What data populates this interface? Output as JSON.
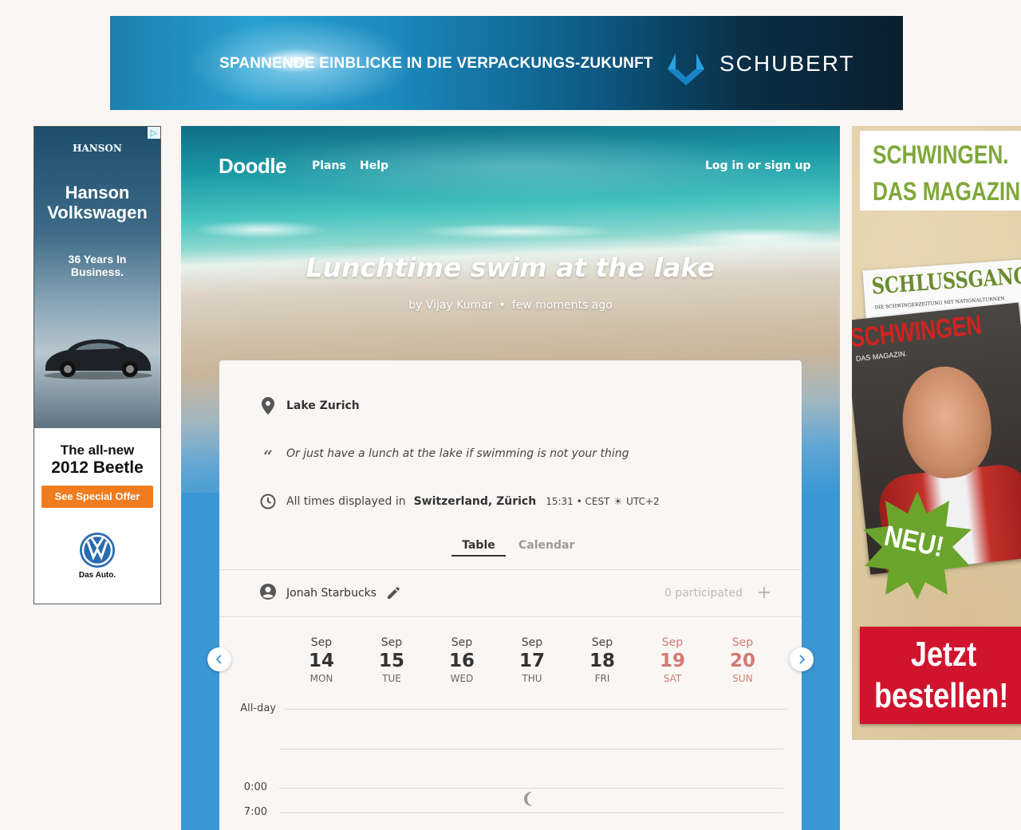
{
  "top_ad": {
    "headline": "SPANNENDE EINBLICKE IN DIE VERPACKUNGS-ZUKUNFT",
    "brand": "SCHUBERT"
  },
  "left_ad": {
    "dealer_logo": "HANSON",
    "title_line1": "Hanson",
    "title_line2": "Volkswagen",
    "tagline_line1": "36 Years In",
    "tagline_line2": "Business.",
    "model_line1": "The all-new",
    "model_line2": "2012 Beetle",
    "offer_button": "See Special Offer",
    "slogan": "Das Auto.",
    "adchoices_icon": "adchoices-icon"
  },
  "right_ad": {
    "headline_line1": "SCHWINGEN.",
    "headline_line2": "DAS MAGAZIN",
    "back_magazine_title": "SCHLUSSGANG",
    "back_magazine_sub": "DIE SCHWINGERZEITUNG MIT NATIONALTURNEN",
    "front_magazine_title": "SCHWINGEN",
    "front_magazine_sub": "DAS MAGAZIN.",
    "burst_text": "NEU!",
    "cta_line1": "Jetzt",
    "cta_line2": "bestellen!"
  },
  "header": {
    "logo": "Doodle",
    "nav": [
      "Plans",
      "Help"
    ],
    "login": "Log in or sign up"
  },
  "poll": {
    "title": "Lunchtime swim at the lake",
    "author": "by Vijay Kumar",
    "time_ago": "few moments ago",
    "location": "Lake Zurich",
    "description": "Or just have a lunch at the lake if swimming is not your thing",
    "timezone_prefix": "All times displayed in",
    "timezone_name": "Switzerland, Zürich",
    "timezone_time": "15:31 • CEST",
    "timezone_offset": "UTC+2"
  },
  "view_tabs": {
    "table": "Table",
    "calendar": "Calendar",
    "active": "Table"
  },
  "participant": {
    "name": "Jonah Starbucks",
    "count_label": "0 participated"
  },
  "days": [
    {
      "month": "Sep",
      "day": "14",
      "weekday": "MON",
      "weekend": false
    },
    {
      "month": "Sep",
      "day": "15",
      "weekday": "TUE",
      "weekend": false
    },
    {
      "month": "Sep",
      "day": "16",
      "weekday": "WED",
      "weekend": false
    },
    {
      "month": "Sep",
      "day": "17",
      "weekday": "THU",
      "weekend": false
    },
    {
      "month": "Sep",
      "day": "18",
      "weekday": "FRI",
      "weekend": false
    },
    {
      "month": "Sep",
      "day": "19",
      "weekday": "SAT",
      "weekend": true
    },
    {
      "month": "Sep",
      "day": "20",
      "weekday": "SUN",
      "weekend": true
    }
  ],
  "time_labels": {
    "all_day": "All-day",
    "t0": "0:00",
    "t7": "7:00"
  },
  "colors": {
    "weekend": "#d27a74",
    "card_bg": "#f9f6f4",
    "page_bg": "#3b97d3",
    "offer_button": "#f07c1f",
    "cta_red": "#d0142d"
  }
}
